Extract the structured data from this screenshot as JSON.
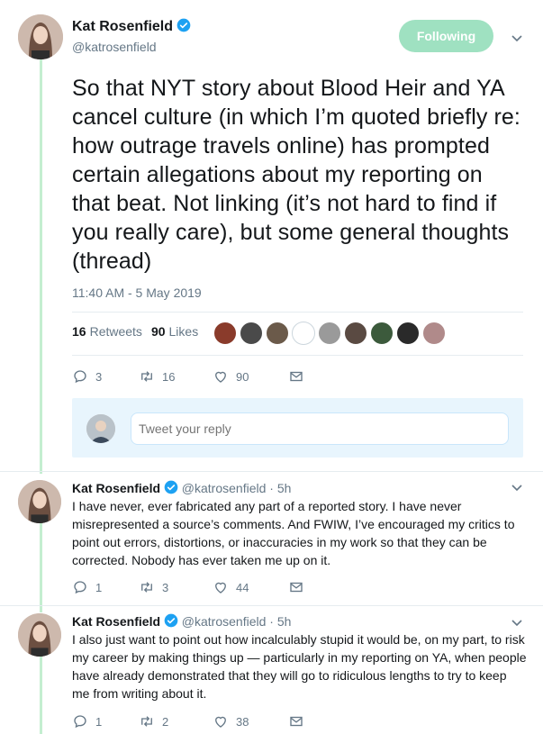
{
  "main_tweet": {
    "author_name": "Kat Rosenfield",
    "author_handle": "@katrosenfield",
    "follow_label": "Following",
    "text": "So that NYT story about Blood Heir and YA cancel culture (in which I’m quoted briefly re: how outrage travels online) has prompted certain allegations about my reporting on that beat. Not linking (it’s not hard to find if you really care), but some general thoughts (thread)",
    "timestamp": "11:40 AM - 5 May 2019",
    "retweets_count": "16",
    "retweets_label": "Retweets",
    "likes_count": "90",
    "likes_label": "Likes",
    "replies": "3",
    "retweets": "16",
    "likes": "90"
  },
  "reply_box": {
    "placeholder": "Tweet your reply"
  },
  "thread": [
    {
      "author_name": "Kat Rosenfield",
      "author_handle": "@katrosenfield",
      "time": "· 5h",
      "text": "I have never, ever fabricated any part of a reported story. I have never misrepresented a source’s comments. And FWIW, I’ve encouraged my critics to point out errors, distortions, or inaccuracies in my work so that they can be corrected. Nobody has ever taken me up on it.",
      "replies": "1",
      "retweets": "3",
      "likes": "44"
    },
    {
      "author_name": "Kat Rosenfield",
      "author_handle": "@katrosenfield",
      "time": "· 5h",
      "text": "I also just want to point out how incalculably stupid it would be, on my part, to risk my career by making things up — particularly in my reporting on YA, when people have already demonstrated that they will go to ridiculous lengths to try to keep me from writing about it.",
      "replies": "1",
      "retweets": "2",
      "likes": "38"
    }
  ],
  "colors": {
    "thread_line": "#c4eed0",
    "follow_button": "#9fe1c1",
    "verified": "#1da1f2",
    "muted": "#657786"
  },
  "likers_colors": [
    "#8a3b2b",
    "#4a4a4a",
    "#6b5a4a",
    "#ffffff",
    "#9a9a9a",
    "#5a4a42",
    "#3c5a3c",
    "#2a2a2a",
    "#b08a8a"
  ]
}
